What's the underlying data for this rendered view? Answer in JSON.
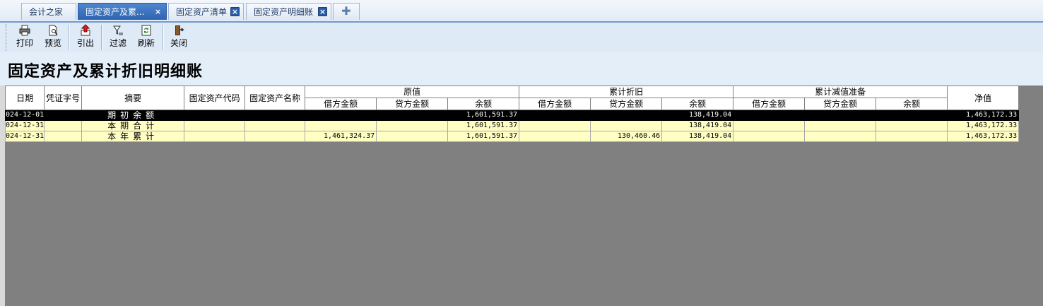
{
  "tabs": [
    {
      "label": "会计之家",
      "closable": false,
      "active": false
    },
    {
      "label": "固定资产及累...",
      "closable": true,
      "active": true
    },
    {
      "label": "固定资产清单",
      "closable": true,
      "active": false
    },
    {
      "label": "固定资产明细账",
      "closable": true,
      "active": false
    }
  ],
  "tab_close_symbol": "×",
  "tab_add_symbol": "✚",
  "toolbar": {
    "print": {
      "label": "打印",
      "icon": "printer-icon"
    },
    "preview": {
      "label": "预览",
      "icon": "preview-icon"
    },
    "export": {
      "label": "引出",
      "icon": "export-icon"
    },
    "filter": {
      "label": "过滤",
      "icon": "filter-icon"
    },
    "refresh": {
      "label": "刷新",
      "icon": "refresh-icon"
    },
    "close": {
      "label": "关闭",
      "icon": "exit-icon"
    }
  },
  "title": "固定资产及累计折旧明细账",
  "table": {
    "headers": {
      "date": "日期",
      "voucher": "凭证字号",
      "summary": "摘要",
      "asset_code": "固定资产代码",
      "asset_name": "固定资产名称",
      "original_value": "原值",
      "accum_depreciation": "累计折旧",
      "accum_impairment": "累计减值准备",
      "net_value": "净值",
      "debit": "借方金额",
      "credit": "贷方金额",
      "balance": "余额"
    },
    "rows": [
      {
        "date": "024-12-01",
        "voucher": "",
        "summary": "期初余额",
        "asset_code": "",
        "asset_name": "",
        "orig_debit": "",
        "orig_credit": "",
        "orig_balance": "1,601,591.37",
        "dep_debit": "",
        "dep_credit": "",
        "dep_balance": "138,419.04",
        "imp_debit": "",
        "imp_credit": "",
        "imp_balance": "",
        "net": "1,463,172.33",
        "style": "black"
      },
      {
        "date": "024-12-31",
        "voucher": "",
        "summary": "本期合计",
        "asset_code": "",
        "asset_name": "",
        "orig_debit": "",
        "orig_credit": "",
        "orig_balance": "1,601,591.37",
        "dep_debit": "",
        "dep_credit": "",
        "dep_balance": "138,419.04",
        "imp_debit": "",
        "imp_credit": "",
        "imp_balance": "",
        "net": "1,463,172.33",
        "style": "yellow"
      },
      {
        "date": "024-12-31",
        "voucher": "",
        "summary": "本年累计",
        "asset_code": "",
        "asset_name": "",
        "orig_debit": "1,461,324.37",
        "orig_credit": "",
        "orig_balance": "1,601,591.37",
        "dep_debit": "",
        "dep_credit": "130,460.46",
        "dep_balance": "138,419.04",
        "imp_debit": "",
        "imp_credit": "",
        "imp_balance": "",
        "net": "1,463,172.33",
        "style": "yellow"
      }
    ]
  },
  "colors": {
    "tab_active": "#2e64b0",
    "title_band": "#e4eef9",
    "row_highlight": "#000000",
    "row_normal": "#ffffc4",
    "empty_area": "#808080"
  }
}
